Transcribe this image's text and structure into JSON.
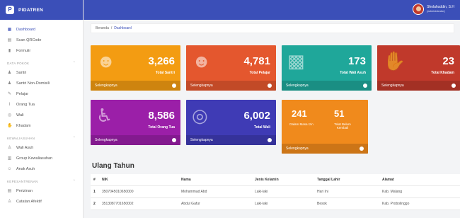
{
  "brand": {
    "name": "PIDATREN"
  },
  "user": {
    "name": "Sholahuddin, S.H",
    "role": "(administrator)"
  },
  "sidebar": {
    "top": [
      {
        "label": "Dashboard",
        "icon": "dashboard-icon"
      },
      {
        "label": "Scan QRCode",
        "icon": "qrcode-icon"
      },
      {
        "label": "Formulir",
        "icon": "form-icon"
      }
    ],
    "sec1": "DATA POKOK",
    "pokok": [
      {
        "label": "Santri"
      },
      {
        "label": "Santri Non-Domisili"
      },
      {
        "label": "Pelajar"
      },
      {
        "label": "Orang Tua"
      },
      {
        "label": "Wali"
      },
      {
        "label": "Khadam"
      }
    ],
    "sec2": "KEWALIASUHAN",
    "asuh": [
      {
        "label": "Wali Asuh"
      },
      {
        "label": "Group Kewaliasuhan"
      },
      {
        "label": "Anak Asuh"
      }
    ],
    "sec3": "KEPESANTRENAN",
    "pes": [
      {
        "label": "Perizinan"
      },
      {
        "label": "Catatan Afektif"
      }
    ]
  },
  "breadcrumb": {
    "home": "Beranda",
    "sep": "/",
    "current": "Dashboard"
  },
  "cards": [
    {
      "value": "3,266",
      "label": "Total Santri",
      "footer": "Selengkapnya",
      "color": "#f39c12"
    },
    {
      "value": "4,781",
      "label": "Total Pelajar",
      "footer": "Selengkapnya",
      "color": "#e4572e"
    },
    {
      "value": "173",
      "label": "Total Wali Asuh",
      "footer": "Selengkapnya",
      "color": "#1fa79a"
    },
    {
      "value": "23",
      "label": "Total Khadam",
      "footer": "Selengkapnya",
      "color": "#c0392b"
    },
    {
      "value": "8,586",
      "label": "Total Orang Tua",
      "footer": "Selengkapnya",
      "color": "#9b1fa8"
    },
    {
      "value": "6,002",
      "label": "Total Wali",
      "footer": "Selengkapnya",
      "color": "#3f3bb5"
    }
  ],
  "small_card": {
    "a_value": "241",
    "a_label": "Dalam Masa Izin",
    "b_value": "51",
    "b_label": "Telat Belum Kembali",
    "footer": "Selengkapnya",
    "color": "#f08a1c"
  },
  "section": {
    "title": "Ulang Tahun"
  },
  "table": {
    "headers": [
      "#",
      "NIK",
      "Nama",
      "Jenis Kelamin",
      "Tanggal Lahir",
      "Alamat"
    ],
    "rows": [
      [
        "1",
        "3507045010650000",
        "Mohammad Abd",
        "Laki-laki",
        "Hari Ini",
        "Kab. Malang"
      ],
      [
        "2",
        "3513087701650002",
        "Abdul Gafur",
        "Laki-laki",
        "Besok",
        "Kab. Probolinggo"
      ]
    ]
  }
}
